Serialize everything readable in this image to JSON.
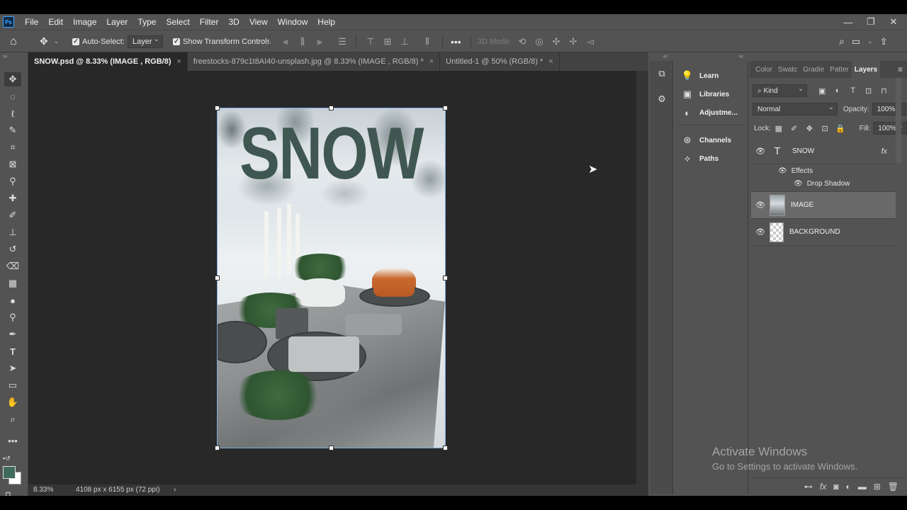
{
  "menubar": {
    "logo": "Ps",
    "items": [
      "File",
      "Edit",
      "Image",
      "Layer",
      "Type",
      "Select",
      "Filter",
      "3D",
      "View",
      "Window",
      "Help"
    ],
    "window_controls": [
      "—",
      "❐",
      "✕"
    ]
  },
  "options": {
    "auto_select_label": "Auto-Select:",
    "auto_select_target": "Layer",
    "show_transform_label": "Show Transform Controls",
    "mode_3d_label": "3D Mode:"
  },
  "tabs": [
    {
      "label": "SNOW.psd @ 8.33% (IMAGE , RGB/8)",
      "close": "×"
    },
    {
      "label": "freestocks-879c1t8AI40-unsplash.jpg @ 8.33% (IMAGE , RGB/8) *",
      "close": "×"
    },
    {
      "label": "Untitled-1 @ 50% (RGB/8) *",
      "close": "×"
    }
  ],
  "document": {
    "headline": "SNOW"
  },
  "status": {
    "zoom": "8.33%",
    "dimensions": "4108 px x 6155 px (72 ppi)",
    "arrow": "›"
  },
  "learn_panel": {
    "items": [
      "Learn",
      "Libraries",
      "Adjustme...",
      "Channels",
      "Paths"
    ]
  },
  "layers_panel": {
    "tabs": [
      "Color",
      "Swatc",
      "Gradie",
      "Patter",
      "Layers"
    ],
    "filter_kind": "Kind",
    "blend_mode": "Normal",
    "opacity_label": "Opacity:",
    "opacity_value": "100%",
    "lock_label": "Lock:",
    "fill_label": "Fill:",
    "fill_value": "100%",
    "layers": [
      {
        "name": "SNOW",
        "type": "text",
        "fx": "fx"
      },
      {
        "name": "IMAGE",
        "type": "image",
        "selected": true
      },
      {
        "name": "BACKGROUND",
        "type": "transparent"
      }
    ],
    "effects_label": "Effects",
    "drop_shadow_label": "Drop Shadow"
  },
  "watermark": {
    "title": "Activate Windows",
    "subtitle": "Go to Settings to activate Windows."
  },
  "colors": {
    "foreground": "#3f6b5c",
    "background": "#ffffff",
    "selection": "#7aa6d8"
  }
}
